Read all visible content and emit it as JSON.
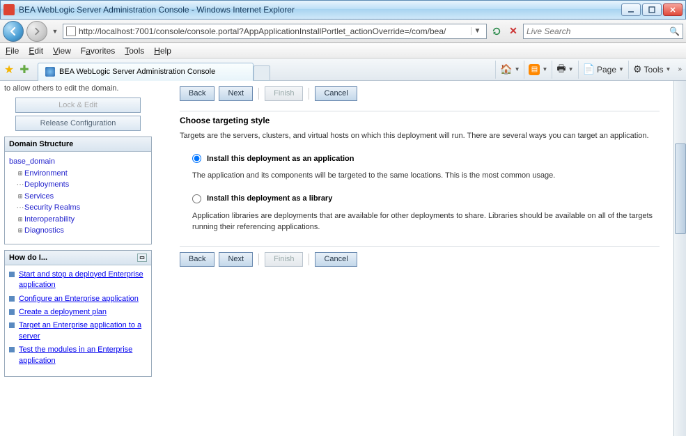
{
  "window": {
    "title": "BEA WebLogic Server Administration Console - Windows Internet Explorer"
  },
  "nav": {
    "url": "http://localhost:7001/console/console.portal?AppApplicationInstallPortlet_actionOverride=/com/bea/",
    "search_placeholder": "Live Search"
  },
  "menu": {
    "file": "File",
    "edit": "Edit",
    "view": "View",
    "favorites": "Favorites",
    "tools": "Tools",
    "help": "Help"
  },
  "cmd": {
    "tab_title": "BEA WebLogic Server Administration Console",
    "page": "Page",
    "tools": "Tools"
  },
  "sidebar": {
    "trunc_text": "to allow others to edit the domain.",
    "lock_btn": "Lock & Edit",
    "release_btn": "Release Configuration",
    "domain_hdr": "Domain Structure",
    "tree": {
      "root": "base_domain",
      "items": [
        "Environment",
        "Deployments",
        "Services",
        "Security Realms",
        "Interoperability",
        "Diagnostics"
      ]
    },
    "howdo_hdr": "How do I...",
    "howdo_items": [
      "Start and stop a deployed Enterprise application",
      "Configure an Enterprise application",
      "Create a deployment plan",
      "Target an Enterprise application to a server",
      "Test the modules in an Enterprise application"
    ]
  },
  "main": {
    "buttons": {
      "back": "Back",
      "next": "Next",
      "finish": "Finish",
      "cancel": "Cancel"
    },
    "heading": "Choose targeting style",
    "intro": "Targets are the servers, clusters, and virtual hosts on which this deployment will run. There are several ways you can target an application.",
    "opt1": {
      "label": "Install this deployment as an application",
      "desc": "The application and its components will be targeted to the same locations. This is the most common usage."
    },
    "opt2": {
      "label": "Install this deployment as a library",
      "desc": "Application libraries are deployments that are available for other deployments to share. Libraries should be available on all of the targets running their referencing applications."
    }
  }
}
